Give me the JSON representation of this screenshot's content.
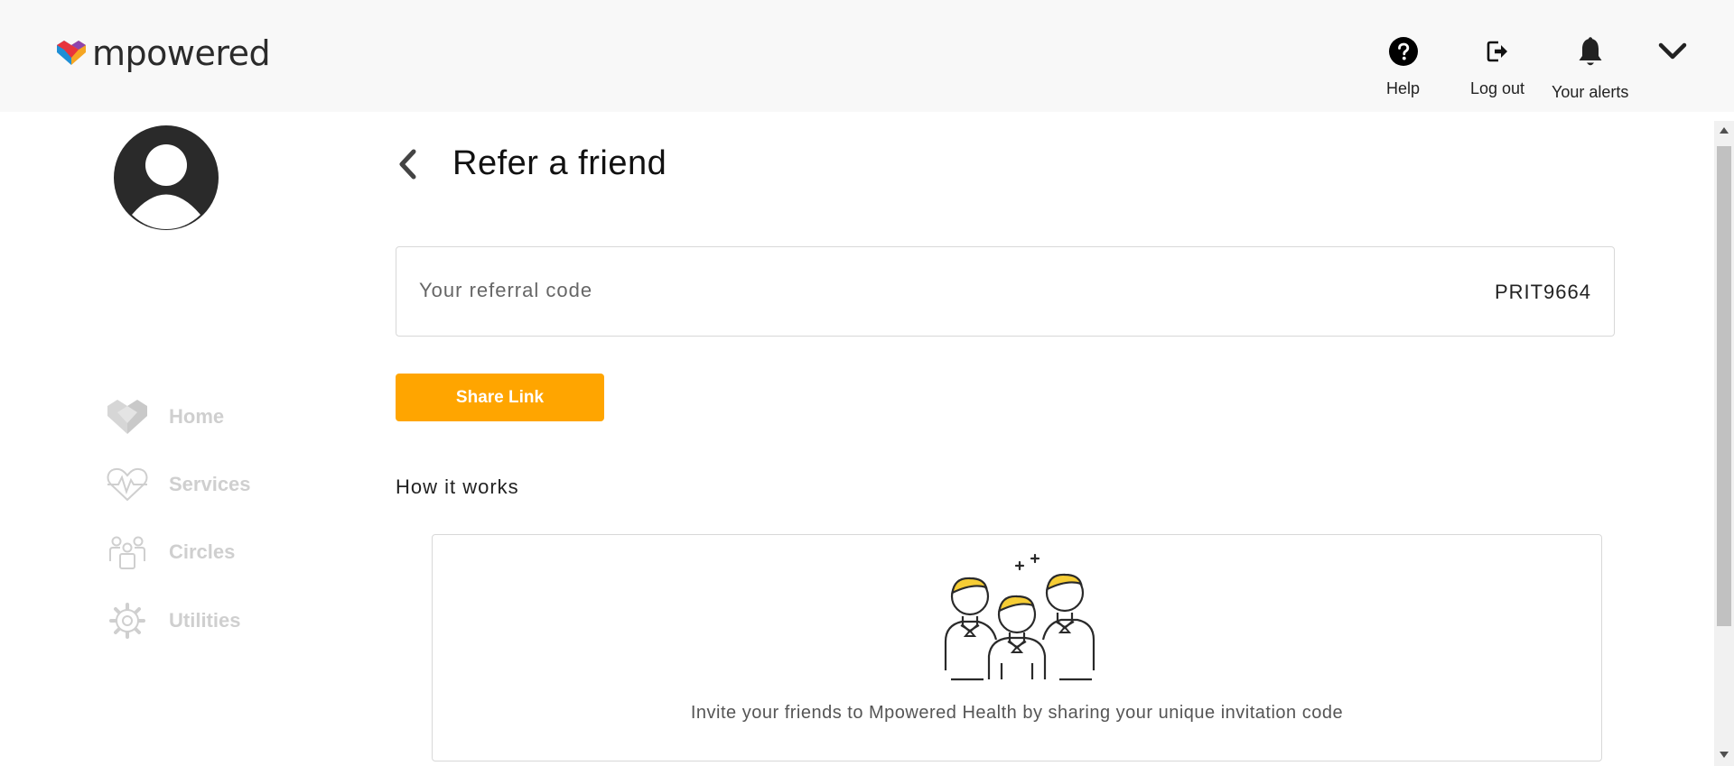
{
  "brand": {
    "name": "mpowered"
  },
  "header": {
    "actions": [
      {
        "label": "Help",
        "icon": "help-icon"
      },
      {
        "label": "Log out",
        "icon": "logout-icon"
      },
      {
        "label": "Your alerts",
        "icon": "bell-icon"
      }
    ],
    "menu_icon": "chevron-down-icon"
  },
  "sidebar": {
    "avatar_icon": "user-avatar-icon",
    "items": [
      {
        "label": "Home",
        "icon": "heart-logo-icon"
      },
      {
        "label": "Services",
        "icon": "heartbeat-icon"
      },
      {
        "label": "Circles",
        "icon": "people-icon"
      },
      {
        "label": "Utilities",
        "icon": "gear-icon"
      }
    ]
  },
  "page": {
    "title": "Refer a friend",
    "referral_label": "Your referral code",
    "referral_code": "PRIT9664",
    "share_button": "Share Link",
    "how_title": "How it works",
    "step_text": "Invite your friends to Mpowered Health by sharing your unique invitation code"
  },
  "colors": {
    "accent": "#ffa500",
    "topbar_bg": "#f8f8f8",
    "nav_text": "#cfcfcf"
  }
}
